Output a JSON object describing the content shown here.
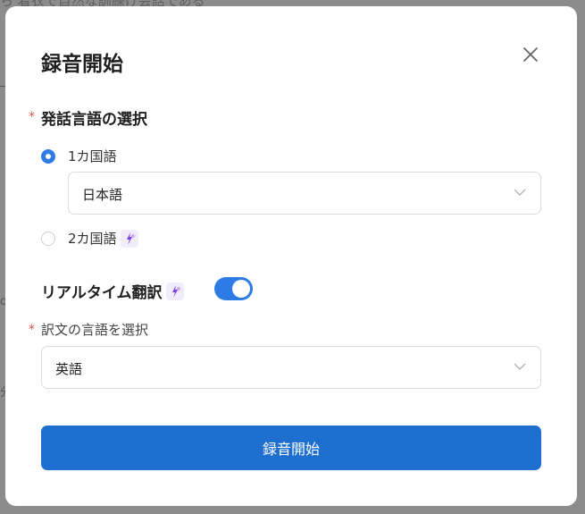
{
  "backdrop": {
    "top_text": "ら 着衣で自然な訓練け会話である",
    "frag1": "o",
    "frag2": "分"
  },
  "modal": {
    "title": "録音開始",
    "close_icon": "close-icon",
    "speech_language": {
      "label": "発話言語の選択",
      "required_mark": "*",
      "options": [
        {
          "label": "1カ国語",
          "checked": true
        },
        {
          "label": "2カ国語",
          "checked": false,
          "badge_icon": "sparkle-icon"
        }
      ],
      "selected_language": "日本語"
    },
    "realtime_translation": {
      "label": "リアルタイム翻訳",
      "badge_icon": "sparkle-icon",
      "enabled": true
    },
    "translation_language": {
      "label": "訳文の言語を選択",
      "required_mark": "*",
      "selected": "英語"
    },
    "start_button": "録音開始"
  },
  "colors": {
    "accent": "#2f7be6",
    "button": "#1e6fd0",
    "required": "#e5534b",
    "sparkle_bg": "#f1ecfa",
    "sparkle_fg": "#7b3fe4"
  }
}
